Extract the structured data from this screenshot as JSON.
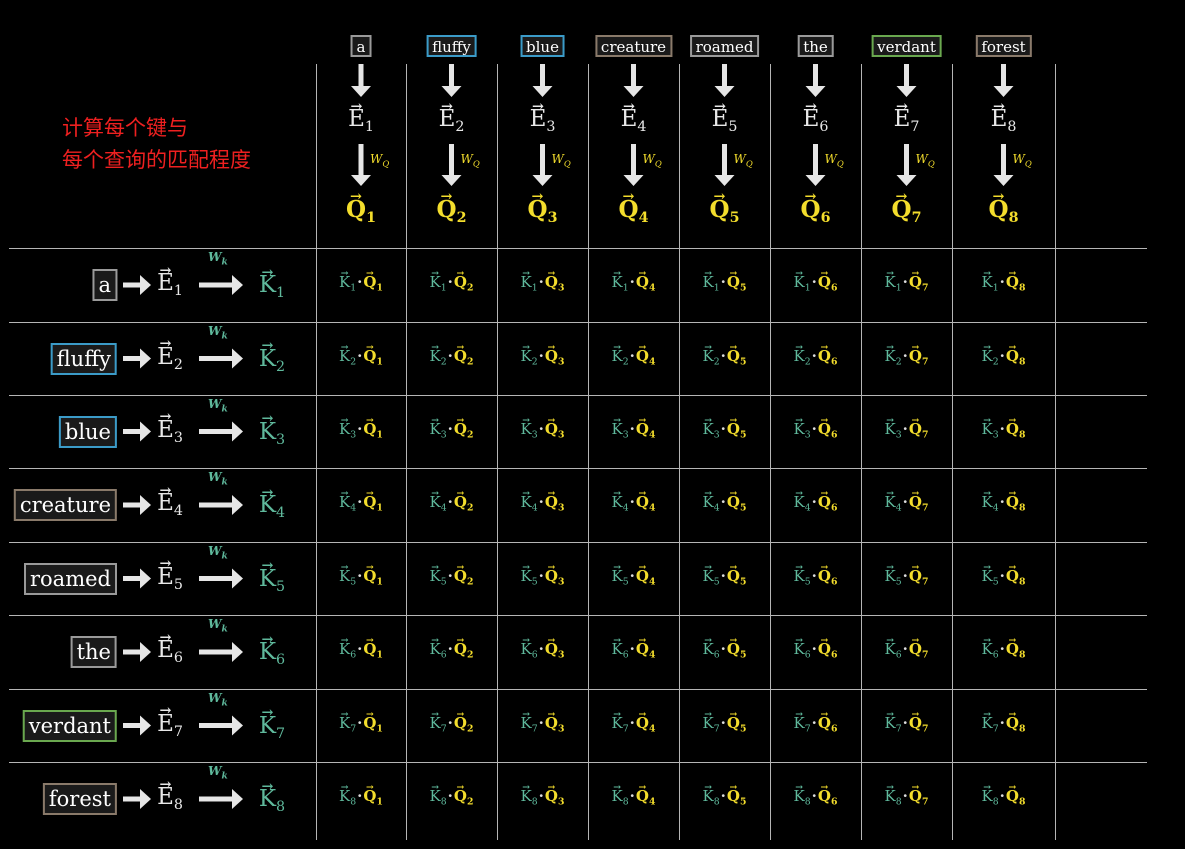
{
  "title": [
    "计算每个键与",
    "每个查询的匹配程度"
  ],
  "tokens": [
    {
      "word": "a",
      "color": "#9a9a9a"
    },
    {
      "word": "fluffy",
      "color": "#3b9bc8"
    },
    {
      "word": "blue",
      "color": "#3b9bc8"
    },
    {
      "word": "creature",
      "color": "#8a7a6a"
    },
    {
      "word": "roamed",
      "color": "#9a9a9a"
    },
    {
      "word": "the",
      "color": "#9a9a9a"
    },
    {
      "word": "verdant",
      "color": "#6aa84f"
    },
    {
      "word": "forest",
      "color": "#8a7a6a"
    }
  ],
  "embedding_symbol": "E",
  "query_symbol": "Q",
  "key_symbol": "K",
  "query_matrix_label": "W",
  "query_matrix_subscript": "Q",
  "key_matrix_label": "W",
  "key_matrix_subscript": "k",
  "colors": {
    "background": "#000000",
    "query": "#f3dd2c",
    "key": "#5fb99c",
    "embedding": "#e8e8e8",
    "title": "#ee2020",
    "grid": "#b5b5b5"
  }
}
